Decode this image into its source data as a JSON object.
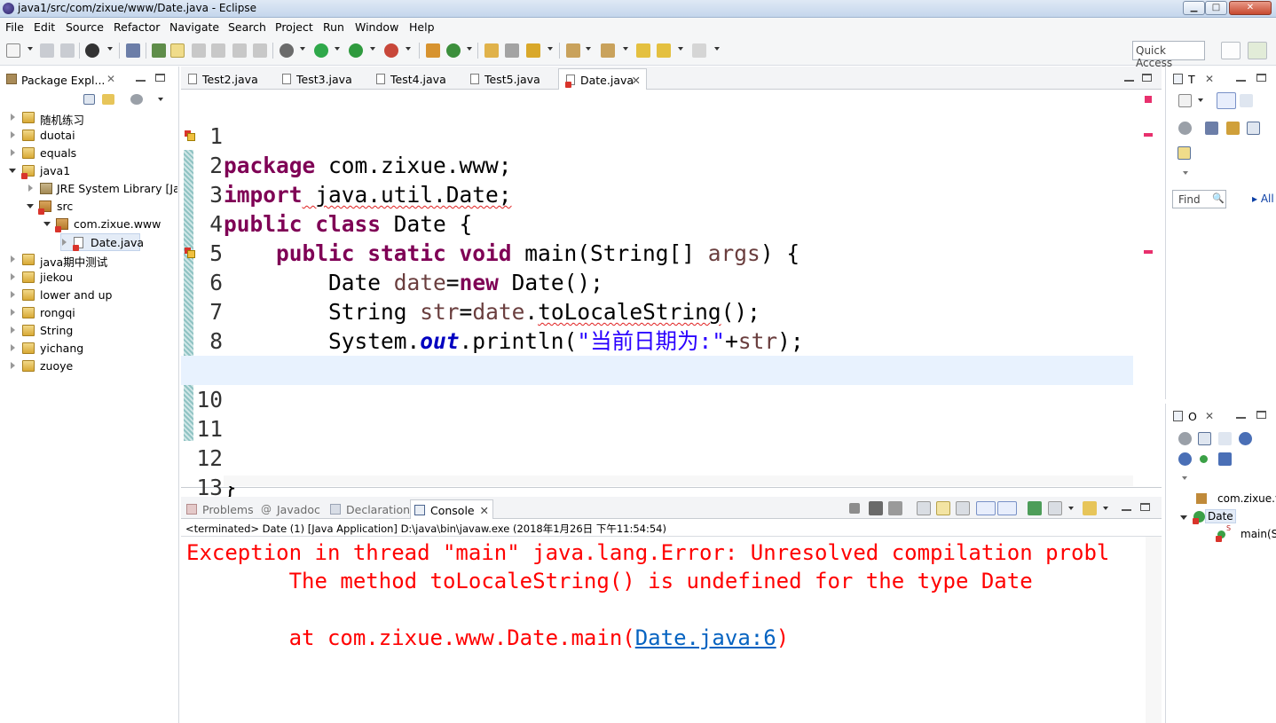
{
  "window": {
    "title": "java1/src/com/zixue/www/Date.java - Eclipse",
    "minimize": "▁",
    "maximize": "□",
    "close": "✕"
  },
  "menu": [
    "File",
    "Edit",
    "Source",
    "Refactor",
    "Navigate",
    "Search",
    "Project",
    "Run",
    "Window",
    "Help"
  ],
  "toolbar": {
    "quick_access_placeholder": "Quick Access"
  },
  "package_explorer": {
    "title": "Package Expl...",
    "close": "✕",
    "items": [
      {
        "label": "随机练习",
        "level": 0,
        "expanded": false,
        "type": "project"
      },
      {
        "label": "duotai",
        "level": 0,
        "expanded": false,
        "type": "project"
      },
      {
        "label": "equals",
        "level": 0,
        "expanded": false,
        "type": "project"
      },
      {
        "label": "java1",
        "level": 0,
        "expanded": true,
        "type": "project"
      },
      {
        "label": "JRE System Library [Jav",
        "level": 1,
        "expanded": false,
        "type": "library"
      },
      {
        "label": "src",
        "level": 1,
        "expanded": true,
        "type": "package"
      },
      {
        "label": "com.zixue.www",
        "level": 2,
        "expanded": true,
        "type": "package"
      },
      {
        "label": "Date.java",
        "level": 3,
        "expanded": false,
        "type": "file"
      },
      {
        "label": "java期中测试",
        "level": 0,
        "expanded": false,
        "type": "project"
      },
      {
        "label": "jiekou",
        "level": 0,
        "expanded": false,
        "type": "project"
      },
      {
        "label": "lower and up",
        "level": 0,
        "expanded": false,
        "type": "project"
      },
      {
        "label": "rongqi",
        "level": 0,
        "expanded": false,
        "type": "project"
      },
      {
        "label": "String",
        "level": 0,
        "expanded": false,
        "type": "project"
      },
      {
        "label": "yichang",
        "level": 0,
        "expanded": false,
        "type": "project"
      },
      {
        "label": "zuoye",
        "level": 0,
        "expanded": false,
        "type": "project"
      }
    ]
  },
  "editor": {
    "tabs": [
      {
        "label": "Test2.java",
        "active": false
      },
      {
        "label": "Test3.java",
        "active": false
      },
      {
        "label": "Test4.java",
        "active": false
      },
      {
        "label": "Test5.java",
        "active": false
      },
      {
        "label": "Date.java",
        "active": true
      }
    ],
    "tab_close": "✕",
    "line_numbers": [
      "1",
      "2",
      "3",
      "4",
      "5",
      "6",
      "7",
      "8",
      "9",
      "10",
      "11",
      "12",
      "13"
    ],
    "lines": {
      "l1_kw": "package",
      "l1_rest": " com.zixue.www;",
      "l2_kw": "import",
      "l2_rest": " java.util.Date;",
      "l3_kw": "public class",
      "l3_rest": " Date {",
      "l4_indent": "    ",
      "l4_kw": "public static void",
      "l4_mid": " main(String[] ",
      "l4_var": "args",
      "l4_end": ") {",
      "l5_indent": "        ",
      "l5_a": "Date ",
      "l5_var": "date",
      "l5_b": "=",
      "l5_kw": "new",
      "l5_c": " Date();",
      "l6_indent": "        ",
      "l6_a": "String ",
      "l6_var1": "str",
      "l6_b": "=",
      "l6_var2": "date",
      "l6_c": ".",
      "l6_err": "toLocaleString",
      "l6_d": "();",
      "l7_indent": "        ",
      "l7_a": "System.",
      "l7_field": "out",
      "l7_b": ".println(",
      "l7_str": "\"当前日期为:\"",
      "l7_c": "+",
      "l7_var": "str",
      "l7_d": ");",
      "l8": "    }",
      "l12": "}"
    }
  },
  "console": {
    "tabs": [
      {
        "label": "Problems",
        "icon": "problems-icon",
        "active": false
      },
      {
        "label": "Javadoc",
        "icon": "at-icon",
        "active": false
      },
      {
        "label": "Declaration",
        "icon": "declaration-icon",
        "active": false
      },
      {
        "label": "Console",
        "icon": "console-icon",
        "active": true
      }
    ],
    "tab_close": "✕",
    "javadoc_glyph": "@",
    "status": "<terminated> Date (1) [Java Application] D:\\java\\bin\\javaw.exe (2018年1月26日 下午11:54:54)",
    "line1": "Exception in thread \"main\" java.lang.Error: Unresolved compilation probl",
    "line2": "        The method toLocaleString() is undefined for the type Date",
    "line3_prefix": "        at com.zixue.www.Date.main(",
    "line3_link": "Date.java:6",
    "line3_suffix": ")"
  },
  "task_panel": {
    "tab_label": "T",
    "close": "✕",
    "find_placeholder": "Find",
    "find_glyph": "🔍",
    "all_label": "▸ All"
  },
  "outline_panel": {
    "tab_label": "O",
    "close": "✕",
    "items": [
      {
        "label": "com.zixue.v"
      },
      {
        "label": "Date"
      },
      {
        "label": "main(S"
      }
    ],
    "static_marker": "S"
  },
  "colors": {
    "keyword": "#7f0055",
    "string": "#2a00ff",
    "error_text": "#ff0000",
    "link": "#0563c1",
    "current_line": "#e8f2fe"
  }
}
